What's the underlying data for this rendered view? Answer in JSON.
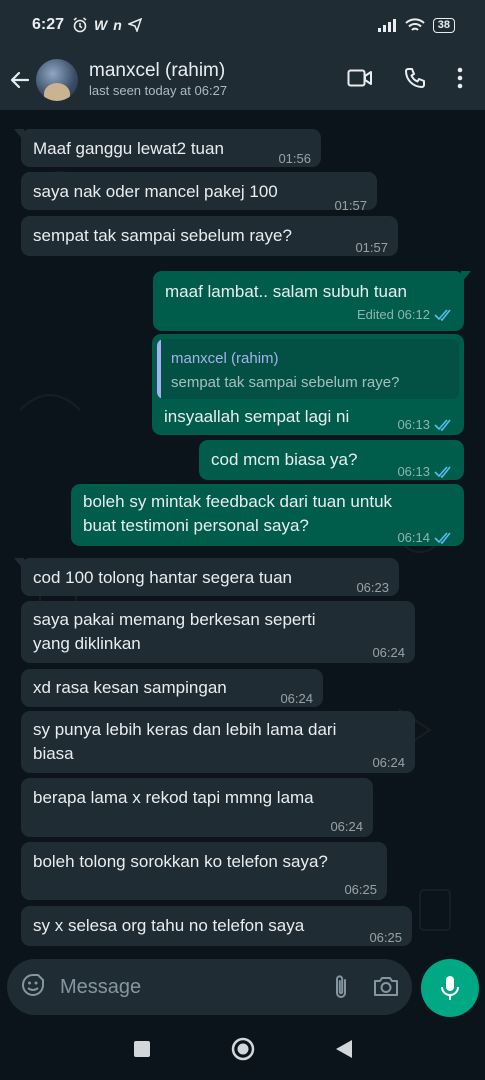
{
  "status_bar": {
    "time": "6:27",
    "battery": "38",
    "notif_labels": [
      "W",
      "n"
    ]
  },
  "header": {
    "contact_name": "manxcel (rahim)",
    "last_seen": "last seen today at 06:27"
  },
  "messages": [
    {
      "dir": "in",
      "lines": [
        "Maaf ganggu lewat2 tuan"
      ],
      "time": "01:56"
    },
    {
      "dir": "in",
      "lines": [
        "saya nak oder mancel pakej 100"
      ],
      "time": "01:57"
    },
    {
      "dir": "in",
      "lines": [
        "sempat tak sampai sebelum raye?"
      ],
      "time": "01:57"
    },
    {
      "dir": "out",
      "lines": [
        "maaf lambat.. salam subuh tuan"
      ],
      "time": "Edited 06:12"
    },
    {
      "dir": "out",
      "quote_name": "manxcel (rahim)",
      "quote_text": "sempat tak sampai sebelum raye?",
      "lines": [
        "insyaallah sempat lagi ni"
      ],
      "time": "06:13"
    },
    {
      "dir": "out",
      "lines": [
        "cod mcm biasa ya?"
      ],
      "time": "06:13"
    },
    {
      "dir": "out",
      "lines": [
        "boleh sy mintak feedback dari tuan untuk",
        "buat testimoni personal saya?"
      ],
      "time": "06:14"
    },
    {
      "dir": "in",
      "lines": [
        "cod 100 tolong hantar segera tuan"
      ],
      "time": "06:23"
    },
    {
      "dir": "in",
      "lines": [
        "saya pakai memang berkesan seperti",
        "yang diklinkan"
      ],
      "time": "06:24"
    },
    {
      "dir": "in",
      "lines": [
        "xd rasa kesan sampingan"
      ],
      "time": "06:24"
    },
    {
      "dir": "in",
      "lines": [
        "sy punya lebih keras dan lebih lama dari",
        "biasa"
      ],
      "time": "06:24"
    },
    {
      "dir": "in",
      "lines": [
        "berapa lama x rekod tapi mmng lama"
      ],
      "time": "06:24"
    },
    {
      "dir": "in",
      "lines": [
        "boleh tolong sorokkan ko telefon saya?"
      ],
      "time": "06:25"
    },
    {
      "dir": "in",
      "lines": [
        "sy x selesa org tahu no telefon saya"
      ],
      "time": "06:25"
    }
  ],
  "composer": {
    "placeholder": "Message"
  },
  "colors": {
    "incoming_bubble": "#202c33",
    "outgoing_bubble": "#005c4b",
    "accent": "#00a884",
    "read_tick": "#53bdeb",
    "quote_name": "#a5b1f0"
  },
  "icons": [
    "back-arrow-icon",
    "video-call-icon",
    "phone-icon",
    "more-options-icon",
    "sticker-icon",
    "attach-icon",
    "camera-icon",
    "mic-icon",
    "recents-icon",
    "home-icon",
    "back-nav-icon",
    "alarm-icon",
    "send-icon",
    "wifi-icon",
    "signal-icon"
  ]
}
